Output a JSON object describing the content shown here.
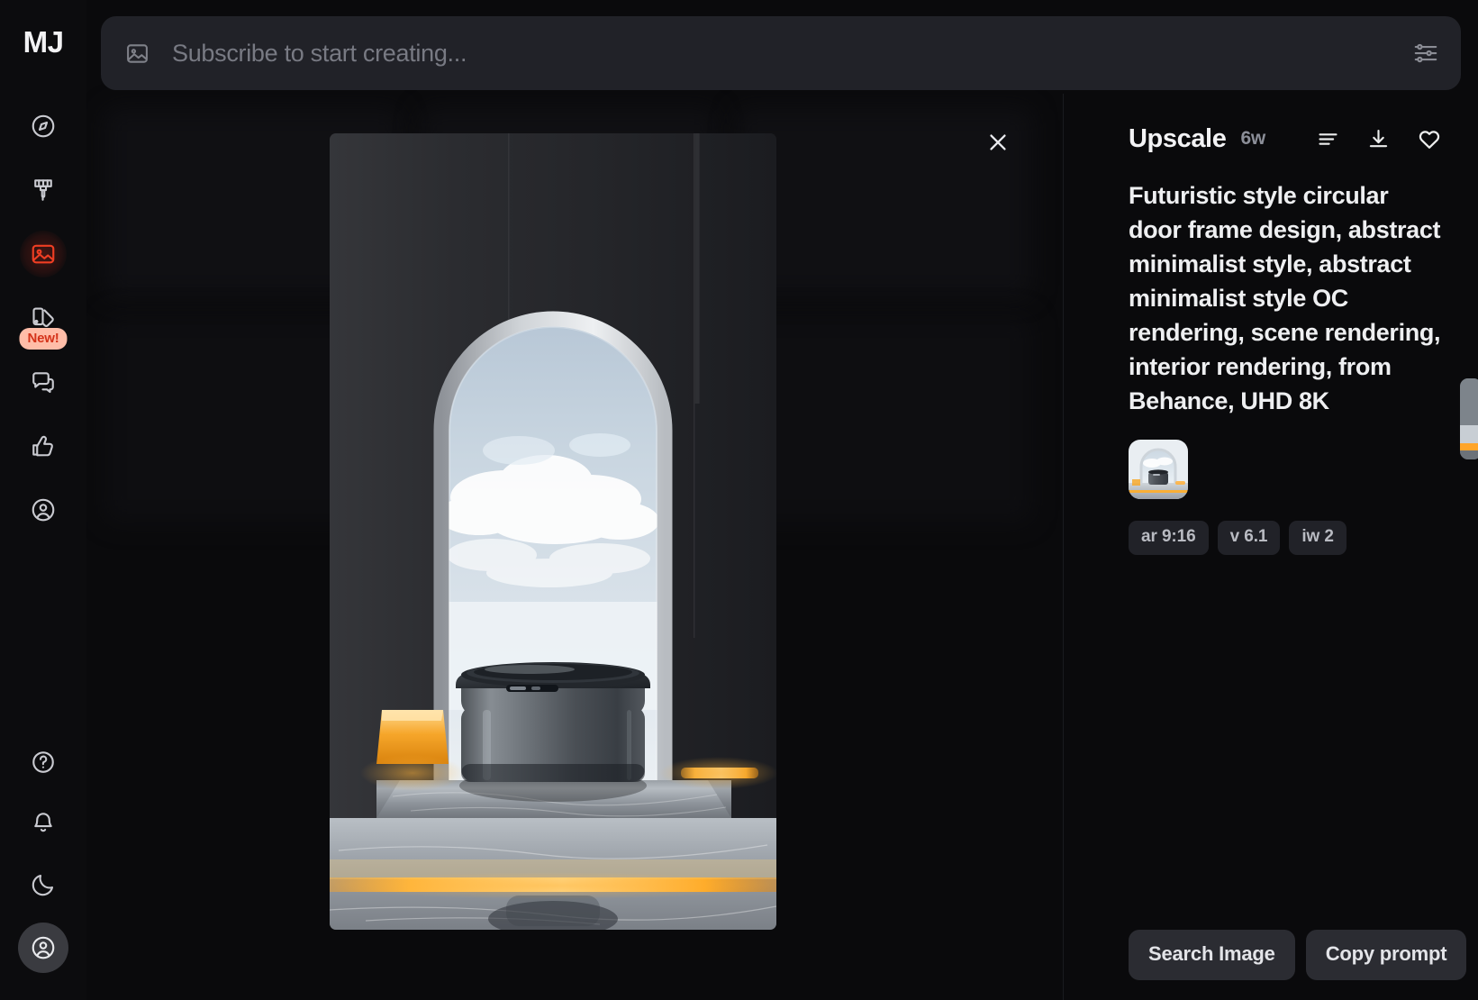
{
  "app": {
    "logo": "MJ",
    "theme_accent": "#ef3e23",
    "background": "#0a0a0c"
  },
  "prompt_bar": {
    "placeholder": "Subscribe to start creating...",
    "value": "",
    "image_icon": "image-icon",
    "settings_icon": "sliders-icon"
  },
  "sidebar": {
    "items": [
      {
        "name": "explore",
        "icon": "compass-icon",
        "active": false,
        "badge": null
      },
      {
        "name": "create",
        "icon": "paintbrush-icon",
        "active": false,
        "badge": null
      },
      {
        "name": "organize",
        "icon": "image-icon",
        "active": true,
        "badge": null
      },
      {
        "name": "personalize",
        "icon": "cards-icon",
        "active": false,
        "badge": "New!"
      },
      {
        "name": "chat",
        "icon": "chat-bubble-icon",
        "active": false,
        "badge": null
      },
      {
        "name": "rate",
        "icon": "thumbs-up-icon",
        "active": false,
        "badge": null
      },
      {
        "name": "account",
        "icon": "user-circle-icon",
        "active": false,
        "badge": null
      }
    ],
    "bottom_items": [
      {
        "name": "help",
        "icon": "question-circle-icon"
      },
      {
        "name": "notifications",
        "icon": "bell-icon"
      },
      {
        "name": "theme-toggle",
        "icon": "moon-icon"
      },
      {
        "name": "profile",
        "icon": "user-circle-icon"
      }
    ]
  },
  "viewer": {
    "close_icon": "close-icon"
  },
  "detail": {
    "title": "Upscale",
    "age": "6w",
    "actions": [
      {
        "name": "options",
        "icon": "lines-menu-icon"
      },
      {
        "name": "download",
        "icon": "download-icon"
      },
      {
        "name": "favorite",
        "icon": "heart-icon"
      }
    ],
    "prompt": "Futuristic style circular door frame design, abstract minimalist style, abstract minimalist style OC rendering, scene rendering, interior rendering, from Behance, UHD 8K",
    "reference_thumb_alt": "reference-image-thumbnail",
    "pills": [
      "ar 9:16",
      "v 6.1",
      "iw 2"
    ],
    "footer_buttons": [
      {
        "name": "search-image",
        "label": "Search Image"
      },
      {
        "name": "copy-prompt",
        "label": "Copy prompt"
      }
    ]
  }
}
